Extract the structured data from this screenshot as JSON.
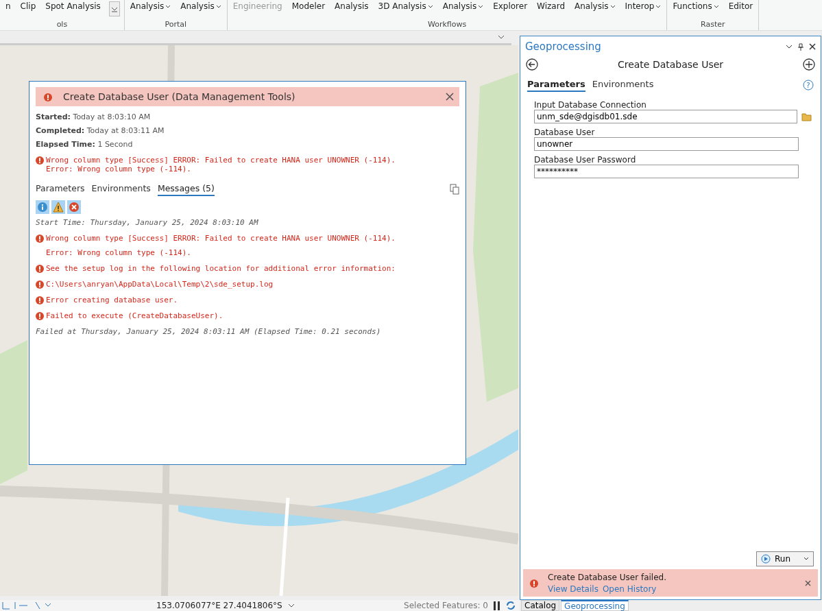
{
  "ribbon": {
    "groups": [
      {
        "label": "ols",
        "buttons": [
          {
            "label": "n",
            "dropdown": false,
            "disabled": false
          },
          {
            "label": "Clip",
            "dropdown": false,
            "disabled": false
          },
          {
            "label": "Spot Analysis",
            "dropdown": false,
            "disabled": false
          }
        ],
        "gallery": true
      },
      {
        "label": "Portal",
        "buttons": [
          {
            "label": "Analysis",
            "dropdown": true,
            "disabled": false
          },
          {
            "label": "Analysis",
            "dropdown": true,
            "disabled": false
          }
        ],
        "gallery": false
      },
      {
        "label": "Workflows",
        "buttons": [
          {
            "label": "Engineering",
            "dropdown": false,
            "disabled": true
          },
          {
            "label": "Modeler",
            "dropdown": false,
            "disabled": false
          },
          {
            "label": "Analysis",
            "dropdown": false,
            "disabled": false
          },
          {
            "label": "3D Analysis",
            "dropdown": true,
            "disabled": false
          },
          {
            "label": "Analysis",
            "dropdown": true,
            "disabled": false
          },
          {
            "label": "Explorer",
            "dropdown": false,
            "disabled": false
          },
          {
            "label": "Wizard",
            "dropdown": false,
            "disabled": false
          },
          {
            "label": "Analysis",
            "dropdown": true,
            "disabled": false
          },
          {
            "label": "Interop",
            "dropdown": true,
            "disabled": false
          }
        ],
        "gallery": false
      },
      {
        "label": "Raster",
        "buttons": [
          {
            "label": "Functions",
            "dropdown": true,
            "disabled": false
          },
          {
            "label": "Editor",
            "dropdown": false,
            "disabled": false
          }
        ],
        "gallery": false
      }
    ]
  },
  "dialog": {
    "title": "Create Database User (Data Management Tools)",
    "summary": [
      {
        "label": "Started:",
        "value": "Today at 8:03:10 AM"
      },
      {
        "label": "Completed:",
        "value": "Today at 8:03:11 AM"
      },
      {
        "label": "Elapsed Time:",
        "value": "1 Second"
      }
    ],
    "error": [
      "Wrong column type [Success] ERROR: Failed to create HANA user UNOWNER (-114).",
      "Error: Wrong column type (-114)."
    ],
    "tabs": [
      {
        "label": "Parameters",
        "selected": false
      },
      {
        "label": "Environments",
        "selected": false
      },
      {
        "label": "Messages (5)",
        "selected": true
      }
    ],
    "filters": [
      {
        "kind": "info",
        "on": true
      },
      {
        "kind": "warning",
        "on": true
      },
      {
        "kind": "error",
        "on": true
      }
    ],
    "messages": [
      {
        "kind": "info",
        "lines": [
          "Start Time: Thursday, January 25, 2024 8:03:10 AM"
        ]
      },
      {
        "kind": "error",
        "lines": [
          "Wrong column type [Success] ERROR: Failed to create HANA user UNOWNER (-114).",
          "Error: Wrong column type (-114)."
        ]
      },
      {
        "kind": "error",
        "lines": [
          "See the setup log in the following location for additional error information:"
        ]
      },
      {
        "kind": "error",
        "lines": [
          "C:\\Users\\anryan\\AppData\\Local\\Temp\\2\\sde_setup.log"
        ]
      },
      {
        "kind": "error",
        "lines": [
          "Error creating database user."
        ]
      },
      {
        "kind": "error",
        "lines": [
          "Failed to execute (CreateDatabaseUser)."
        ]
      },
      {
        "kind": "info",
        "lines": [
          "Failed at Thursday, January 25, 2024 8:03:11 AM (Elapsed Time: 0.21 seconds)"
        ]
      }
    ]
  },
  "pane": {
    "title": "Geoprocessing",
    "tool": "Create Database User",
    "tabs": [
      {
        "label": "Parameters",
        "selected": true
      },
      {
        "label": "Environments",
        "selected": false
      }
    ],
    "help": "?",
    "fields": [
      {
        "label": "Input Database Connection",
        "value": "unm_sde@dgisdb01.sde",
        "browse": true
      },
      {
        "label": "Database User",
        "value": "unowner",
        "browse": false
      },
      {
        "label": "Database User Password",
        "value": "**********",
        "browse": false
      }
    ],
    "run": "Run",
    "banner": {
      "message": "Create Database User failed.",
      "links": [
        "View Details",
        "Open History"
      ]
    },
    "bottom_tabs": [
      {
        "label": "Catalog",
        "selected": false
      },
      {
        "label": "Geoprocessing",
        "selected": true
      }
    ]
  },
  "status_bar": {
    "coordinates": "153.0706077°E 27.4041806°S",
    "selected_features": "Selected Features: 0"
  }
}
